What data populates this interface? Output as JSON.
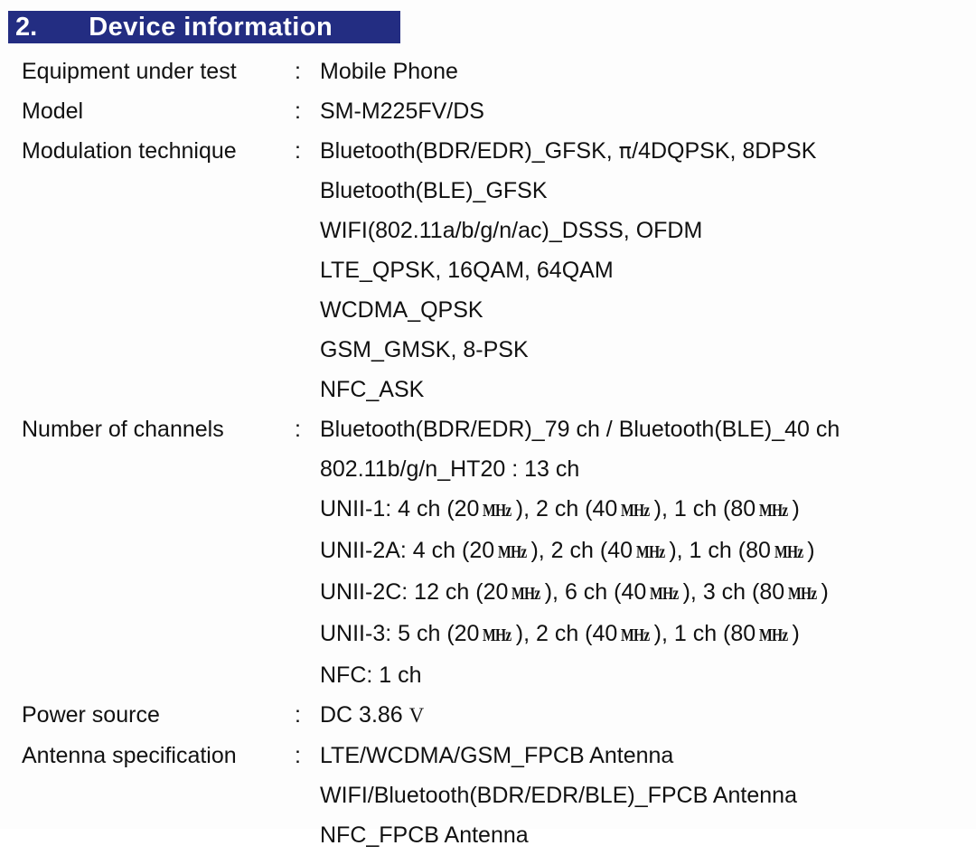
{
  "section": {
    "number": "2.",
    "title": "Device information",
    "accent_color": "#232d82",
    "title_color": "#ffffff"
  },
  "separator": ":",
  "rows": [
    {
      "label": "Equipment under test",
      "values": [
        {
          "parts": [
            {
              "t": "Mobile Phone"
            }
          ]
        }
      ]
    },
    {
      "label": "Model",
      "values": [
        {
          "parts": [
            {
              "t": "SM-M225FV/DS"
            }
          ]
        }
      ]
    },
    {
      "label": "Modulation technique",
      "values": [
        {
          "parts": [
            {
              "t": "Bluetooth(BDR/EDR)_GFSK, "
            },
            {
              "t": "π",
              "style": "pi"
            },
            {
              "t": "/4DQPSK, 8DPSK"
            }
          ]
        },
        {
          "parts": [
            {
              "t": "Bluetooth(BLE)_GFSK"
            }
          ]
        },
        {
          "parts": [
            {
              "t": "WIFI(802.11a/b/g/n/ac)_DSSS, OFDM"
            }
          ]
        },
        {
          "parts": [
            {
              "t": "LTE_QPSK, 16QAM, 64QAM"
            }
          ]
        },
        {
          "parts": [
            {
              "t": "WCDMA_QPSK"
            }
          ]
        },
        {
          "parts": [
            {
              "t": "GSM_GMSK, 8-PSK"
            }
          ]
        },
        {
          "parts": [
            {
              "t": "NFC_ASK"
            }
          ]
        }
      ]
    },
    {
      "label": "Number of channels",
      "values": [
        {
          "parts": [
            {
              "t": "Bluetooth(BDR/EDR)_79 ch / Bluetooth(BLE)_40 ch"
            }
          ]
        },
        {
          "parts": [
            {
              "t": "802.11b/g/n_HT20 : 13 ch"
            }
          ]
        },
        {
          "parts": [
            {
              "t": "UNII-1: 4 ch (20"
            },
            {
              "t": "MHz",
              "style": "unit"
            },
            {
              "t": "), 2 ch (40"
            },
            {
              "t": "MHz",
              "style": "unit"
            },
            {
              "t": "), 1 ch (80"
            },
            {
              "t": "MHz",
              "style": "unit"
            },
            {
              "t": ")"
            }
          ]
        },
        {
          "parts": [
            {
              "t": "UNII-2A: 4 ch (20"
            },
            {
              "t": "MHz",
              "style": "unit"
            },
            {
              "t": "), 2 ch (40"
            },
            {
              "t": "MHz",
              "style": "unit"
            },
            {
              "t": "), 1 ch (80"
            },
            {
              "t": "MHz",
              "style": "unit"
            },
            {
              "t": ")"
            }
          ]
        },
        {
          "parts": [
            {
              "t": "UNII-2C: 12 ch (20"
            },
            {
              "t": "MHz",
              "style": "unit"
            },
            {
              "t": "), 6 ch (40"
            },
            {
              "t": "MHz",
              "style": "unit"
            },
            {
              "t": "), 3 ch (80"
            },
            {
              "t": "MHz",
              "style": "unit"
            },
            {
              "t": ")"
            }
          ]
        },
        {
          "parts": [
            {
              "t": "UNII-3: 5 ch (20"
            },
            {
              "t": "MHz",
              "style": "unit"
            },
            {
              "t": "), 2 ch (40"
            },
            {
              "t": "MHz",
              "style": "unit"
            },
            {
              "t": "), 1 ch (80"
            },
            {
              "t": "MHz",
              "style": "unit"
            },
            {
              "t": ")"
            }
          ]
        },
        {
          "parts": [
            {
              "t": "NFC: 1 ch"
            }
          ]
        }
      ]
    },
    {
      "label": "Power source",
      "values": [
        {
          "parts": [
            {
              "t": "DC 3.86 "
            },
            {
              "t": "V",
              "style": "unit-v"
            }
          ]
        }
      ]
    },
    {
      "label": "Antenna specification",
      "values": [
        {
          "parts": [
            {
              "t": "LTE/WCDMA/GSM_FPCB Antenna"
            }
          ]
        },
        {
          "parts": [
            {
              "t": "WIFI/Bluetooth(BDR/EDR/BLE)_FPCB Antenna"
            }
          ]
        },
        {
          "parts": [
            {
              "t": "NFC_FPCB Antenna"
            }
          ]
        }
      ]
    }
  ]
}
